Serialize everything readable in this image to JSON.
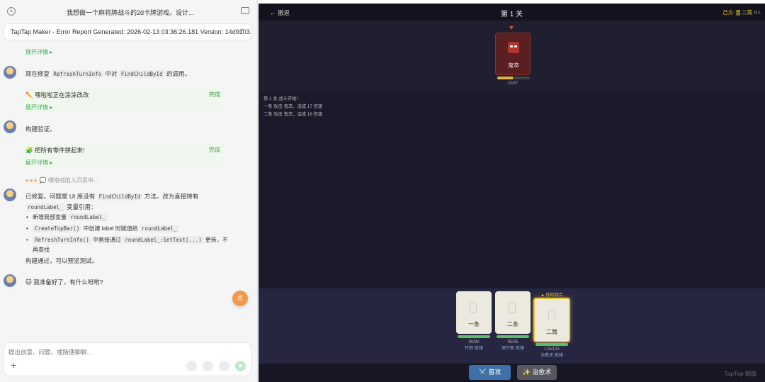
{
  "chat": {
    "title": "我想做一个麻将牌战斗的2d卡牌游戏。设计...",
    "report": "TapTap Maker - Error Report Generated: 2026-02-13 03:36:26.181 Version: 14d9103...",
    "expand_label": "展开详情 ▸",
    "msg1_pre": "现在修复",
    "msg1_code1": "RefreshTurnInfo",
    "msg1_mid": "中对",
    "msg1_code2": "FindChildById",
    "msg1_post": "的调用。",
    "card1_title": "✏️ 嘿啦啦正在涂涂改改",
    "done_label": "完成",
    "msg2": "构建验证。",
    "card2_title": "🧩 把所有零件拼起来!",
    "thinking_dots": "●●●",
    "thinking_text": "💭 嘿啦啦陷入沉思中...",
    "msg3_a": "已修复。问题是 UI 库没有",
    "msg3_code1": "FindChildById",
    "msg3_b": "方法。改为直接持有",
    "msg3_code2": "roundLabel_",
    "msg3_c": "变量引用：",
    "bullets": [
      {
        "pre": "新增局部变量",
        "code": "roundLabel_",
        "post": ""
      },
      {
        "pre": "",
        "code": "CreateTopBar()",
        "post": "中创建 label 时赋值给",
        "code2": "roundLabel_"
      },
      {
        "pre": "",
        "code": "RefreshTurnInfo()",
        "post": "中直接通过",
        "code2": "roundLabel_:SetText(...)",
        "post2": "更新，不再查找"
      }
    ],
    "msg4": "构建通过，可以预览测试。",
    "msg5": "🐱 我准备好了，有什么吩咐?",
    "fab_label": "点",
    "composer_placeholder": "提出创意、问题，或随便聊聊..."
  },
  "game": {
    "back_label": "← 撤退",
    "level_title": "第 1 关",
    "turn_side": "己方: 🀫 二筒",
    "turn_round": "R1",
    "enemy": {
      "name": "鬼卒",
      "hp_text": "32/67",
      "hp_fraction": 0.48
    },
    "log": [
      "第 1 关 战斗开始!",
      "一条 攻击 鬼卒，造成 17 伤害",
      "二条 攻击 鬼卒，造成 18 伤害"
    ],
    "your_turn_label": "▲ 你的回合",
    "players": [
      {
        "name": "一条",
        "hp_text": "90/90",
        "hp_fraction": 1.0,
        "status": "竹刺 就绪"
      },
      {
        "name": "二条",
        "hp_text": "95/95",
        "hp_fraction": 1.0,
        "status": "双竹斩 就绪"
      },
      {
        "name": "二筒",
        "hp_text": "125/125",
        "hp_fraction": 1.0,
        "status": "治愈术 就绪"
      }
    ],
    "attack_label": "⚔️ 普攻",
    "heal_label": "✨ 治愈术",
    "watermark": "TapTap 制造"
  }
}
